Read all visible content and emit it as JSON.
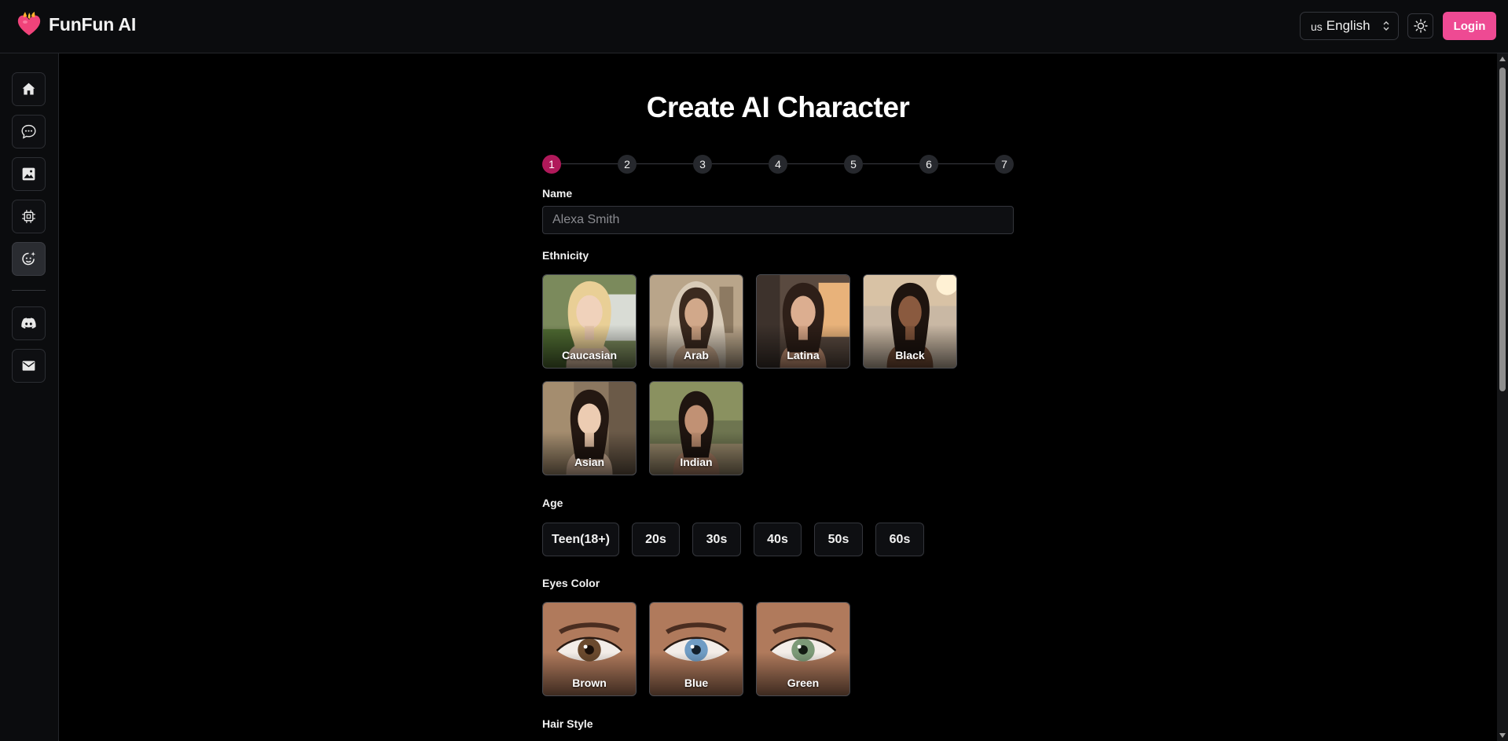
{
  "header": {
    "brand_name": "FunFun AI",
    "language_flag": "us",
    "language_label": "English",
    "login_label": "Login"
  },
  "sidebar": {
    "items": [
      {
        "name": "home",
        "icon": "home-icon"
      },
      {
        "name": "chat",
        "icon": "chat-bubble-icon"
      },
      {
        "name": "images",
        "icon": "image-icon"
      },
      {
        "name": "models",
        "icon": "chip-icon"
      },
      {
        "name": "create-character",
        "icon": "face-sparkle-icon",
        "active": true
      },
      {
        "name": "discord",
        "icon": "discord-icon"
      },
      {
        "name": "mail",
        "icon": "mail-icon"
      }
    ]
  },
  "page": {
    "title": "Create AI Character",
    "steps": [
      "1",
      "2",
      "3",
      "4",
      "5",
      "6",
      "7"
    ],
    "active_step": 1
  },
  "form": {
    "name_label": "Name",
    "name_placeholder": "Alexa Smith",
    "ethnicity_label": "Ethnicity",
    "ethnicity_options": [
      "Caucasian",
      "Arab",
      "Latina",
      "Black",
      "Asian",
      "Indian"
    ],
    "age_label": "Age",
    "age_options": [
      "Teen(18+)",
      "20s",
      "30s",
      "40s",
      "50s",
      "60s"
    ],
    "eyes_label": "Eyes Color",
    "eyes_options": [
      "Brown",
      "Blue",
      "Green"
    ],
    "hair_label": "Hair Style"
  },
  "colors": {
    "accent": "#ee4a93",
    "step_active": "#b0195a",
    "background": "#000000",
    "panel": "#0b0c0e"
  }
}
